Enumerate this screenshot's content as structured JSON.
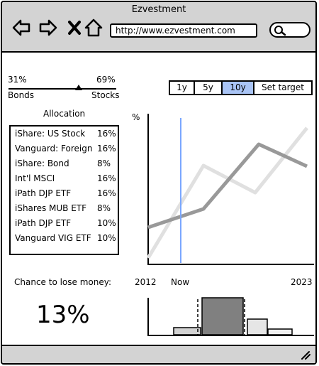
{
  "window": {
    "title": "Ezvestment"
  },
  "browser": {
    "url": "http://www.ezvestment.com"
  },
  "slider": {
    "left_pct": "31%",
    "right_pct": "69%",
    "left_label": "Bonds",
    "right_label": "Stocks",
    "value": 0.69
  },
  "range_tabs": [
    {
      "label": "1y",
      "active": false
    },
    {
      "label": "5y",
      "active": false
    },
    {
      "label": "10y",
      "active": true
    },
    {
      "label": "Set target",
      "active": false
    }
  ],
  "allocation": {
    "heading": "Allocation",
    "items": [
      {
        "name": "iShare: US Stock",
        "pct": "16%"
      },
      {
        "name": "Vanguard: Foreign",
        "pct": "16%"
      },
      {
        "name": "iShare: Bond",
        "pct": "8%"
      },
      {
        "name": "Int'l MSCI",
        "pct": "16%"
      },
      {
        "name": "iPath DJP ETF",
        "pct": "16%"
      },
      {
        "name": "iShares MUB ETF",
        "pct": "8%"
      },
      {
        "name": "iPath DJP ETF",
        "pct": "10%"
      },
      {
        "name": "Vanguard VIG ETF",
        "pct": "10%"
      }
    ]
  },
  "chart": {
    "y_unit": "%",
    "x_start": "2012",
    "x_now": "Now",
    "x_end": "2023"
  },
  "risk": {
    "label": "Chance to lose money:",
    "value": "13%"
  },
  "colors": {
    "chrome": "#d3d3d3",
    "active_tab": "#a9c4f5",
    "now_line": "#7aa7ff"
  }
}
